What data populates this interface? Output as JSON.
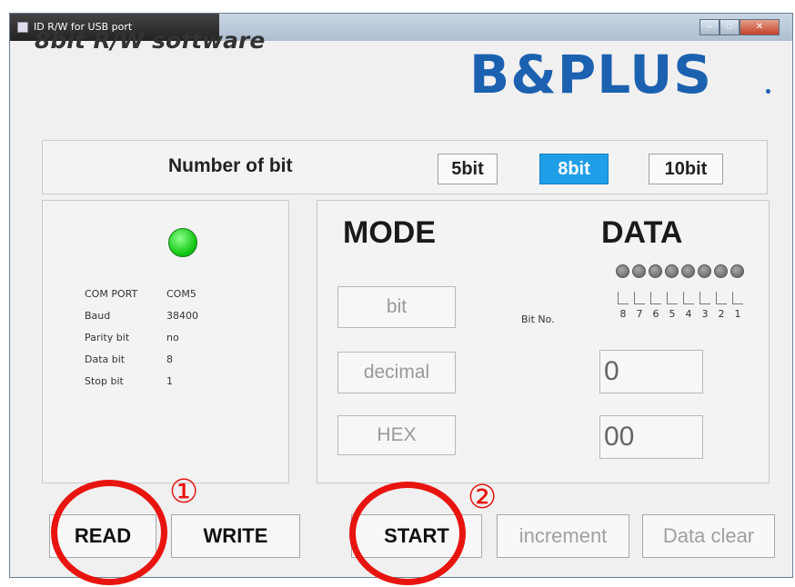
{
  "window": {
    "title": "ID R/W for USB port"
  },
  "header": {
    "title": "8bit R/W software",
    "logo": "B&PLUS"
  },
  "bit_selector": {
    "label": "Number of bit",
    "options": [
      "5bit",
      "8bit",
      "10bit"
    ],
    "selected": "8bit"
  },
  "port_info": {
    "led": "green",
    "rows": [
      {
        "key": "COM PORT",
        "value": "COM5"
      },
      {
        "key": "Baud",
        "value": "38400"
      },
      {
        "key": "Parity bit",
        "value": "no"
      },
      {
        "key": "Data bit",
        "value": "8"
      },
      {
        "key": "Stop bit",
        "value": "1"
      }
    ]
  },
  "mode": {
    "title": "MODE",
    "buttons": {
      "bit": "bit",
      "decimal": "decimal",
      "hex": "HEX"
    }
  },
  "data": {
    "title": "DATA",
    "bit_no_label": "Bit No.",
    "bit_numbers": [
      "8",
      "7",
      "6",
      "5",
      "4",
      "3",
      "2",
      "1"
    ],
    "decimal_value": "0",
    "hex_value": "00"
  },
  "actions": {
    "read": "READ",
    "write": "WRITE",
    "start": "START",
    "increment": "increment",
    "clear": "Data clear"
  },
  "annotations": {
    "step1": "①",
    "step2": "②",
    "color": "#e8140f"
  }
}
